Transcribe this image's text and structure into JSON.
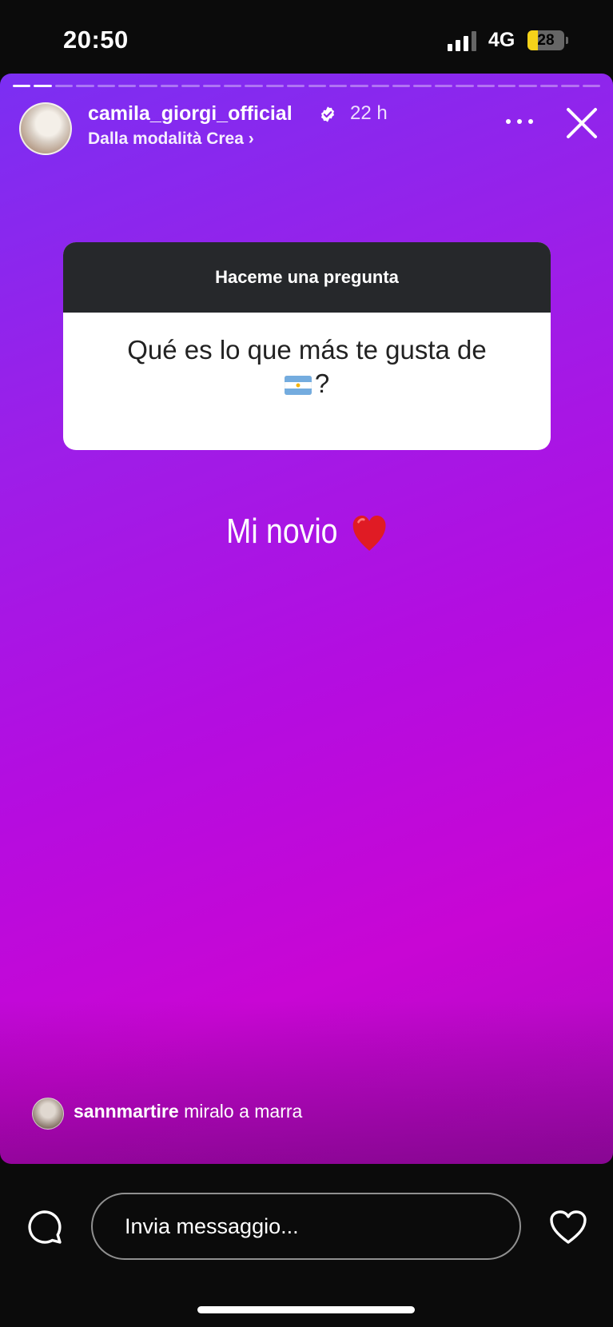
{
  "status_bar": {
    "time": "20:50",
    "network": "4G",
    "battery_level": "28"
  },
  "story": {
    "progress_segments": 28,
    "progress_done": 2,
    "author": {
      "username": "camila_giorgi_official",
      "verified": true,
      "time_ago": "22 h",
      "subline": "Dalla modalità Crea ›"
    },
    "question_sticker": {
      "header": "Haceme una pregunta",
      "question_line1": "Qué es lo que más te gusta de",
      "question_line2": "?",
      "flag_icon": "argentina-flag-icon"
    },
    "answer": {
      "text": "Mi novio",
      "emoji": "red-heart-icon"
    },
    "reply": {
      "username": "sannmartire",
      "text": "miralo a marra"
    }
  },
  "bottom_bar": {
    "message_placeholder": "Invia messaggio...",
    "left_icon": "chat-bubble-icon",
    "right_icon": "heart-outline-icon"
  },
  "colors": {
    "gradient_start": "#7b2ff2",
    "gradient_end": "#c806d4",
    "question_header_bg": "#26282b"
  }
}
